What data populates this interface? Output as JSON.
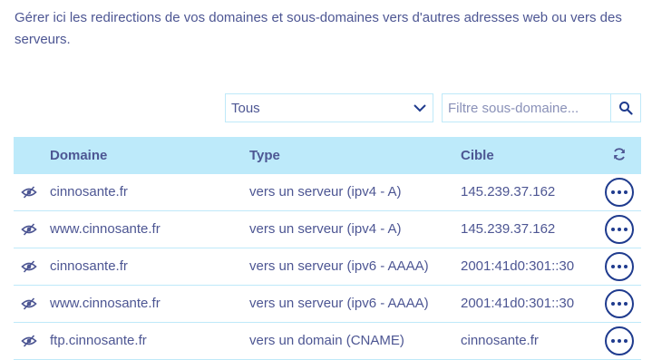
{
  "intro_text": "Gérer ici les redirections de vos domaines et sous-domaines vers d'autres adresses web ou vers des serveurs.",
  "filter": {
    "selected": "Tous",
    "search_placeholder": "Filtre sous-domaine..."
  },
  "table": {
    "headers": {
      "domain": "Domaine",
      "type": "Type",
      "target": "Cible"
    },
    "rows": [
      {
        "domain": "cinnosante.fr",
        "type": "vers un serveur (ipv4 - A)",
        "target": "145.239.37.162"
      },
      {
        "domain": "www.cinnosante.fr",
        "type": "vers un serveur (ipv4 - A)",
        "target": "145.239.37.162"
      },
      {
        "domain": "cinnosante.fr",
        "type": "vers un serveur (ipv6 - AAAA)",
        "target": "2001:41d0:301::30"
      },
      {
        "domain": "www.cinnosante.fr",
        "type": "vers un serveur (ipv6 - AAAA)",
        "target": "2001:41d0:301::30"
      },
      {
        "domain": "ftp.cinnosante.fr",
        "type": "vers un domain (CNAME)",
        "target": "cinnosante.fr"
      }
    ]
  },
  "colors": {
    "text": "#4d5693",
    "header_bg": "#bdeafa",
    "border": "#bfe9f9",
    "accent": "#1f3b8e"
  }
}
